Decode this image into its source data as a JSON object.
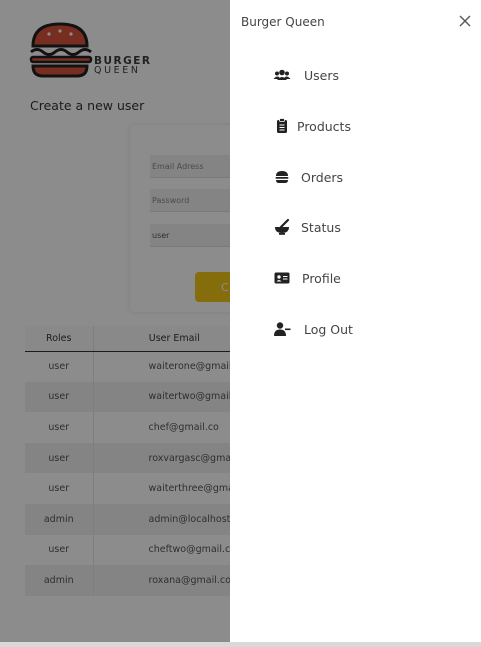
{
  "app": {
    "brand_line1": "BURGER",
    "brand_line2": "QUEEN",
    "page_title": "Create a new user",
    "form": {
      "email_placeholder": "Email Adress",
      "password_placeholder": "Password",
      "role_value": "user",
      "create_label": "C"
    },
    "table": {
      "headers": [
        "Roles",
        "User Email"
      ],
      "rows": [
        {
          "role": "user",
          "email": "waiterone@gmail.c"
        },
        {
          "role": "user",
          "email": "waitertwo@gmail.c"
        },
        {
          "role": "user",
          "email": "chef@gmail.co"
        },
        {
          "role": "user",
          "email": "roxvargasc@gmail"
        },
        {
          "role": "user",
          "email": "waiterthree@gmail"
        },
        {
          "role": "admin",
          "email": "admin@localhost.c"
        },
        {
          "role": "user",
          "email": "cheftwo@gmail.c"
        },
        {
          "role": "admin",
          "email": "roxana@gmail.co"
        }
      ]
    }
  },
  "drawer": {
    "title": "Burger Queen",
    "items": [
      {
        "label": "Users",
        "icon": "users-icon"
      },
      {
        "label": "Products",
        "icon": "clipboard-icon"
      },
      {
        "label": "Orders",
        "icon": "burger-icon"
      },
      {
        "label": "Status",
        "icon": "mortar-pestle-icon"
      },
      {
        "label": "Profile",
        "icon": "id-card-icon"
      },
      {
        "label": "Log Out",
        "icon": "user-minus-icon"
      }
    ]
  },
  "colors": {
    "accent": "#f3c614",
    "logo_red": "#d9553b",
    "overlay": "rgba(0,0,0,0.45)"
  }
}
